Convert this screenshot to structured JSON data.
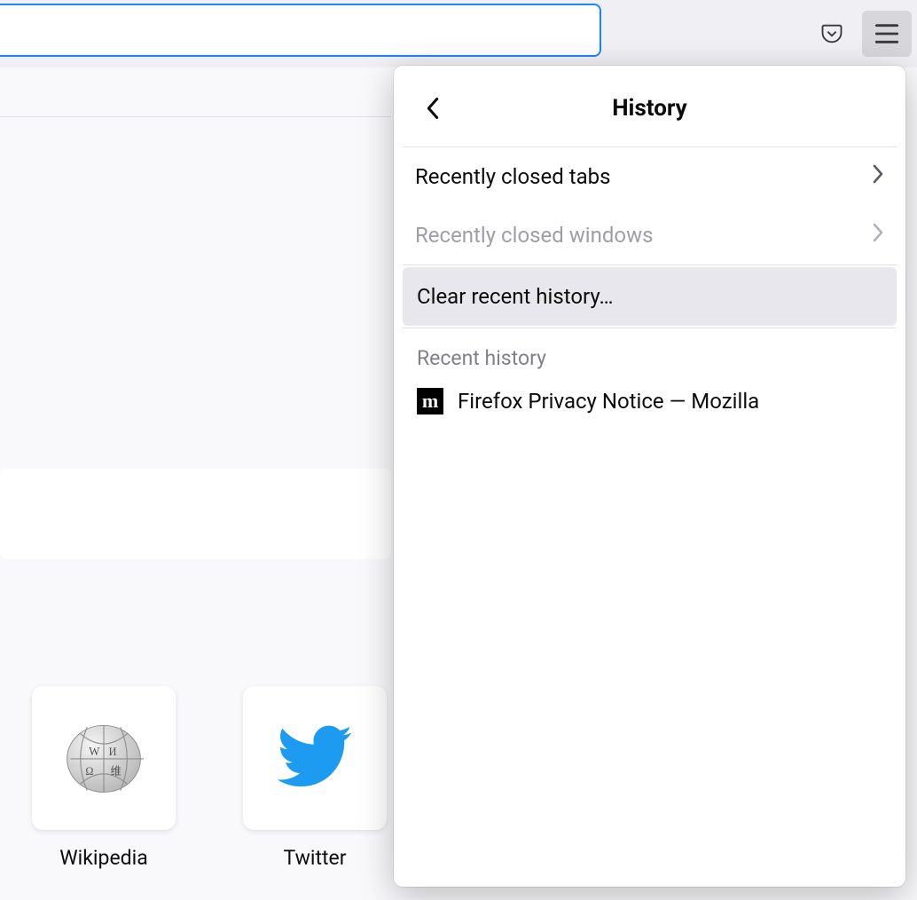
{
  "toolbar": {
    "pocket_icon": "pocket-icon",
    "menu_icon": "hamburger-icon"
  },
  "history_panel": {
    "title": "History",
    "items": {
      "recently_closed_tabs": "Recently closed tabs",
      "recently_closed_windows": "Recently closed windows",
      "clear_recent": "Clear recent history…"
    },
    "section_label": "Recent history",
    "entries": [
      {
        "title": "Firefox Privacy Notice — Mozilla",
        "icon": "mozilla"
      }
    ]
  },
  "topsites": [
    {
      "label": "Wikipedia",
      "icon": "wikipedia"
    },
    {
      "label": "Twitter",
      "icon": "twitter"
    }
  ]
}
